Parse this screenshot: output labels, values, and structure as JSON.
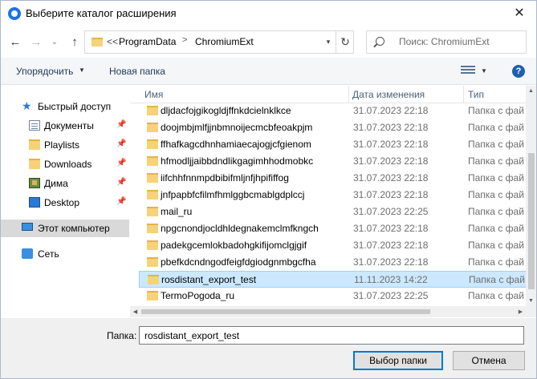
{
  "window": {
    "title": "Выберите каталог расширения"
  },
  "address": {
    "overflow": "<<",
    "crumbs": [
      "ProgramData",
      "ChromiumExt"
    ],
    "separator": ">"
  },
  "search": {
    "placeholder": "Поиск: ChromiumExt"
  },
  "toolbar": {
    "organize": "Упорядочить",
    "new_folder": "Новая папка",
    "help": "?"
  },
  "nav": {
    "quick_access": "Быстрый доступ",
    "items": [
      {
        "label": "Документы",
        "icon": "documents-icon",
        "pinned": true
      },
      {
        "label": "Playlists",
        "icon": "folder-icon",
        "pinned": true
      },
      {
        "label": "Downloads",
        "icon": "folder-icon",
        "pinned": true
      },
      {
        "label": "Дима",
        "icon": "user-folder-icon",
        "pinned": true
      },
      {
        "label": "Desktop",
        "icon": "desktop-icon",
        "pinned": true
      }
    ],
    "this_pc": "Этот компьютер",
    "network": "Сеть"
  },
  "columns": {
    "name": "Имя",
    "date": "Дата изменения",
    "type": "Тип"
  },
  "files": [
    {
      "name": "dljdacfojgikogldjffnkdcielnklkce",
      "date": "31.07.2023 22:18",
      "type": "Папка с фай"
    },
    {
      "name": "doojmbjmlfjjnbmnoijecmcbfeoakpjm",
      "date": "31.07.2023 22:18",
      "type": "Папка с фай"
    },
    {
      "name": "ffhafkagcdhnhamiaecajogjcfgienom",
      "date": "31.07.2023 22:18",
      "type": "Папка с фай"
    },
    {
      "name": "hfmodljjaibbdndlikgagimhhodmobkc",
      "date": "31.07.2023 22:18",
      "type": "Папка с фай"
    },
    {
      "name": "iifchhfnnmpdbibifmljnfjhpififfog",
      "date": "31.07.2023 22:18",
      "type": "Папка с фай"
    },
    {
      "name": "jnfpapbfcfilmfhmlggbcmablgdplccj",
      "date": "31.07.2023 22:18",
      "type": "Папка с фай"
    },
    {
      "name": "mail_ru",
      "date": "31.07.2023 22:25",
      "type": "Папка с фай"
    },
    {
      "name": "npgcnondjocldhldegnakemclmfkngch",
      "date": "31.07.2023 22:18",
      "type": "Папка с фай"
    },
    {
      "name": "padekgcemlokbadohgkifijomclgjgif",
      "date": "31.07.2023 22:18",
      "type": "Папка с фай"
    },
    {
      "name": "pbefkdcndngodfeigfdgiodgnmbgcfha",
      "date": "31.07.2023 22:18",
      "type": "Папка с фай"
    },
    {
      "name": "rosdistant_export_test",
      "date": "11.11.2023 14:22",
      "type": "Папка с фай",
      "selected": true
    },
    {
      "name": "TermoPogoda_ru",
      "date": "31.07.2023 22:25",
      "type": "Папка с фай"
    }
  ],
  "bottom": {
    "folder_label": "Папка:",
    "folder_value": "rosdistant_export_test",
    "ok": "Выбор папки",
    "cancel": "Отмена"
  }
}
